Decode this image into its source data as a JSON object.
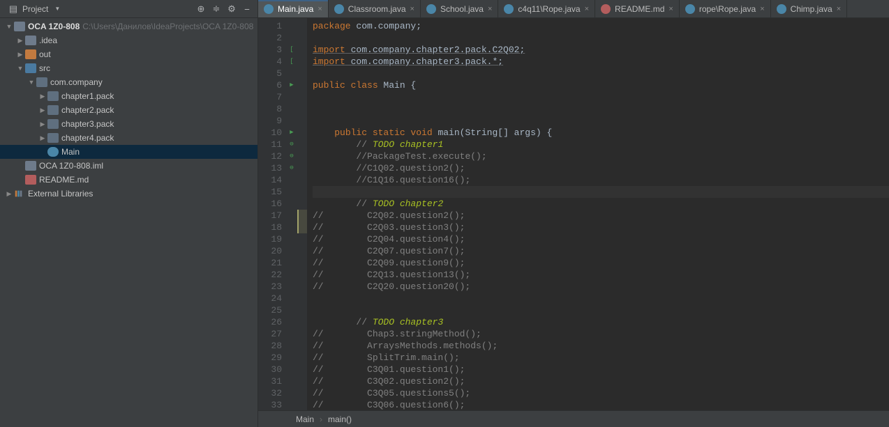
{
  "sidebar": {
    "title": "Project",
    "root": {
      "name": "OCA 1Z0-808",
      "path": "C:\\Users\\Данилов\\IdeaProjects\\OCA 1Z0-808"
    },
    "ideaFolder": ".idea",
    "outFolder": "out",
    "srcFolder": "src",
    "packageName": "com.company",
    "chapters": [
      "chapter1.pack",
      "chapter2.pack",
      "chapter3.pack",
      "chapter4.pack"
    ],
    "mainClass": "Main",
    "imlFile": "OCA 1Z0-808.iml",
    "readme": "README.md",
    "extLib": "External Libraries"
  },
  "tabs": [
    {
      "label": "Main.java",
      "active": true,
      "kind": "java"
    },
    {
      "label": "Classroom.java",
      "active": false,
      "kind": "java"
    },
    {
      "label": "School.java",
      "active": false,
      "kind": "java"
    },
    {
      "label": "c4q11\\Rope.java",
      "active": false,
      "kind": "java"
    },
    {
      "label": "README.md",
      "active": false,
      "kind": "md"
    },
    {
      "label": "rope\\Rope.java",
      "active": false,
      "kind": "java"
    },
    {
      "label": "Chimp.java",
      "active": false,
      "kind": "java"
    }
  ],
  "gutter_marks": {
    "3": "[",
    "4": "[",
    "6": "▶",
    "10": "▶",
    "11": "⊖",
    "12": "⊖",
    "13": "⊖"
  },
  "bm_marks": [
    17,
    18
  ],
  "code_lines": [
    {
      "n": 1,
      "html": "<span class='tok-kw'>package</span> com.company;"
    },
    {
      "n": 2,
      "html": ""
    },
    {
      "n": 3,
      "html": "<span class='tok-kw underline'>import</span><span class='underline'> com.company.chapter2.pack.C2Q02;</span>"
    },
    {
      "n": 4,
      "html": "<span class='tok-kw underline'>import</span><span class='underline'> com.company.chapter3.pack.*;</span>"
    },
    {
      "n": 5,
      "html": ""
    },
    {
      "n": 6,
      "html": "<span class='tok-kw'>public class</span> Main {"
    },
    {
      "n": 7,
      "html": ""
    },
    {
      "n": 8,
      "html": ""
    },
    {
      "n": 9,
      "html": ""
    },
    {
      "n": 10,
      "html": "    <span class='tok-kw'>public static void</span> main(String[] args) {"
    },
    {
      "n": 11,
      "html": "        <span class='tok-cmt'>// </span><span class='tok-todo'>TODO chapter1</span>"
    },
    {
      "n": 12,
      "html": "        <span class='tok-cmt'>//PackageTest.execute();</span>"
    },
    {
      "n": 13,
      "html": "        <span class='tok-cmt'>//C1Q02.question2();</span>"
    },
    {
      "n": 14,
      "html": "        <span class='tok-cmt'>//C1Q16.question16();</span>"
    },
    {
      "n": 15,
      "html": "",
      "hl": true
    },
    {
      "n": 16,
      "html": "        <span class='tok-cmt'>// </span><span class='tok-todo'>TODO chapter2</span>"
    },
    {
      "n": 17,
      "html": "<span class='tok-cmt'>//        C2Q02.question2();</span>"
    },
    {
      "n": 18,
      "html": "<span class='tok-cmt'>//        C2Q03.question3();</span>"
    },
    {
      "n": 19,
      "html": "<span class='tok-cmt'>//        C2Q04.question4();</span>"
    },
    {
      "n": 20,
      "html": "<span class='tok-cmt'>//        C2Q07.question7();</span>"
    },
    {
      "n": 21,
      "html": "<span class='tok-cmt'>//        C2Q09.question9();</span>"
    },
    {
      "n": 22,
      "html": "<span class='tok-cmt'>//        C2Q13.question13();</span>"
    },
    {
      "n": 23,
      "html": "<span class='tok-cmt'>//        C2Q20.question20();</span>"
    },
    {
      "n": 24,
      "html": ""
    },
    {
      "n": 25,
      "html": ""
    },
    {
      "n": 26,
      "html": "        <span class='tok-cmt'>// </span><span class='tok-todo'>TODO chapter3</span>"
    },
    {
      "n": 27,
      "html": "<span class='tok-cmt'>//        Chap3.stringMethod();</span>"
    },
    {
      "n": 28,
      "html": "<span class='tok-cmt'>//        ArraysMethods.methods();</span>"
    },
    {
      "n": 29,
      "html": "<span class='tok-cmt'>//        SplitTrim.main();</span>"
    },
    {
      "n": 30,
      "html": "<span class='tok-cmt'>//        C3Q01.question1();</span>"
    },
    {
      "n": 31,
      "html": "<span class='tok-cmt'>//        C3Q02.question2();</span>"
    },
    {
      "n": 32,
      "html": "<span class='tok-cmt'>//        C3Q05.questions5();</span>"
    },
    {
      "n": 33,
      "html": "<span class='tok-cmt'>//        C3Q06.question6();</span>"
    }
  ],
  "breadcrumb": {
    "class": "Main",
    "method": "main()"
  }
}
